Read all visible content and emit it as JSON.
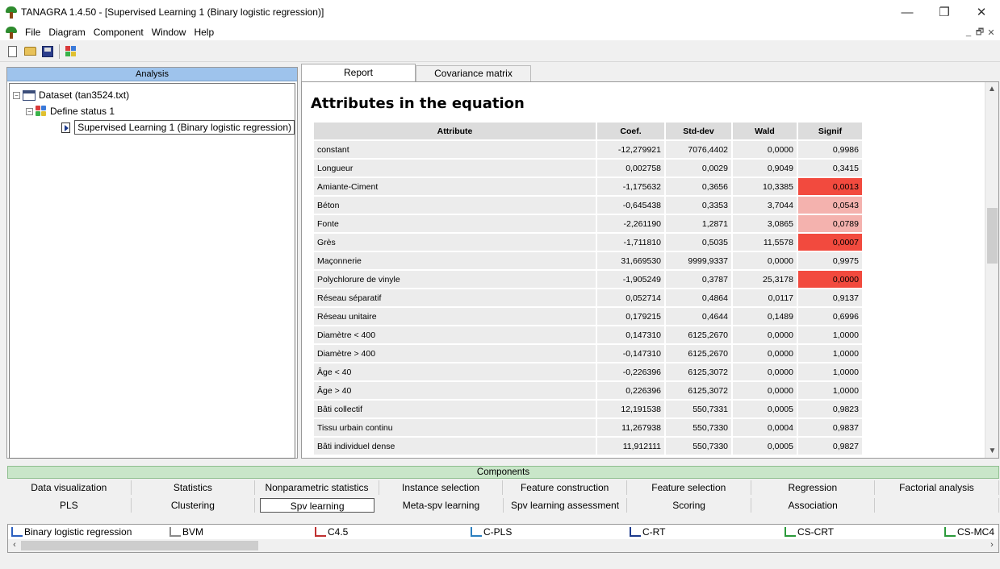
{
  "window": {
    "title": "TANAGRA 1.4.50 - [Supervised Learning 1 (Binary logistic regression)]",
    "minimize": "—",
    "maximize": "❐",
    "close": "✕"
  },
  "menu": {
    "items": [
      "File",
      "Diagram",
      "Component",
      "Window",
      "Help"
    ],
    "mdi": [
      "_",
      "🗗",
      "✕"
    ]
  },
  "toolbar": {
    "icons": [
      "new-file-icon",
      "open-folder-icon",
      "save-disk-icon",
      "execute-icon"
    ]
  },
  "analysis": {
    "header": "Analysis",
    "tree": [
      {
        "label": "Dataset (tan3524.txt)",
        "icon": "dataset-grid-icon",
        "expander": "−"
      },
      {
        "label": "Define status 1",
        "icon": "define-status-icon",
        "expander": "−"
      },
      {
        "label": "Supervised Learning 1 (Binary logistic regression)",
        "icon": "learning-arrow-icon"
      }
    ]
  },
  "tabs": [
    {
      "label": "Report",
      "active": true
    },
    {
      "label": "Covariance matrix",
      "active": false
    }
  ],
  "report": {
    "title": "Attributes in the equation",
    "columns": [
      "Attribute",
      "Coef.",
      "Std-dev",
      "Wald",
      "Signif"
    ],
    "rows": [
      {
        "attr": "constant",
        "coef": "-12,279921",
        "std": "7076,4402",
        "wald": "0,0000",
        "signif": "0,9986",
        "level": "none"
      },
      {
        "attr": "Longueur",
        "coef": "0,002758",
        "std": "0,0029",
        "wald": "0,9049",
        "signif": "0,3415",
        "level": "none"
      },
      {
        "attr": "Amiante-Ciment",
        "coef": "-1,175632",
        "std": "0,3656",
        "wald": "10,3385",
        "signif": "0,0013",
        "level": "strong"
      },
      {
        "attr": "Béton",
        "coef": "-0,645438",
        "std": "0,3353",
        "wald": "3,7044",
        "signif": "0,0543",
        "level": "weak"
      },
      {
        "attr": "Fonte",
        "coef": "-2,261190",
        "std": "1,2871",
        "wald": "3,0865",
        "signif": "0,0789",
        "level": "weak"
      },
      {
        "attr": "Grès",
        "coef": "-1,711810",
        "std": "0,5035",
        "wald": "11,5578",
        "signif": "0,0007",
        "level": "strong"
      },
      {
        "attr": "Maçonnerie",
        "coef": "31,669530",
        "std": "9999,9337",
        "wald": "0,0000",
        "signif": "0,9975",
        "level": "none"
      },
      {
        "attr": "Polychlorure de vinyle",
        "coef": "-1,905249",
        "std": "0,3787",
        "wald": "25,3178",
        "signif": "0,0000",
        "level": "strong"
      },
      {
        "attr": "Réseau séparatif",
        "coef": "0,052714",
        "std": "0,4864",
        "wald": "0,0117",
        "signif": "0,9137",
        "level": "none"
      },
      {
        "attr": "Réseau unitaire",
        "coef": "0,179215",
        "std": "0,4644",
        "wald": "0,1489",
        "signif": "0,6996",
        "level": "none"
      },
      {
        "attr": "Diamètre < 400",
        "coef": "0,147310",
        "std": "6125,2670",
        "wald": "0,0000",
        "signif": "1,0000",
        "level": "none"
      },
      {
        "attr": "Diamètre > 400",
        "coef": "-0,147310",
        "std": "6125,2670",
        "wald": "0,0000",
        "signif": "1,0000",
        "level": "none"
      },
      {
        "attr": "Âge < 40",
        "coef": "-0,226396",
        "std": "6125,3072",
        "wald": "0,0000",
        "signif": "1,0000",
        "level": "none"
      },
      {
        "attr": "Âge > 40",
        "coef": "0,226396",
        "std": "6125,3072",
        "wald": "0,0000",
        "signif": "1,0000",
        "level": "none"
      },
      {
        "attr": "Bâti collectif",
        "coef": "12,191538",
        "std": "550,7331",
        "wald": "0,0005",
        "signif": "0,9823",
        "level": "none"
      },
      {
        "attr": "Tissu urbain continu",
        "coef": "11,267938",
        "std": "550,7330",
        "wald": "0,0004",
        "signif": "0,9837",
        "level": "none"
      },
      {
        "attr": "Bâti individuel dense",
        "coef": "11,912111",
        "std": "550,7330",
        "wald": "0,0005",
        "signif": "0,9827",
        "level": "none"
      }
    ],
    "colors": {
      "strong": "#f24a3e",
      "weak": "#f4b2ae"
    }
  },
  "components": {
    "header": "Components",
    "row1": [
      "Data visualization",
      "Statistics",
      "Nonparametric statistics",
      "Instance selection",
      "Feature construction",
      "Feature selection",
      "Regression",
      "Factorial analysis"
    ],
    "row2": [
      "PLS",
      "Clustering",
      "Spv learning",
      "Meta-spv learning",
      "Spv learning assessment",
      "Scoring",
      "Association",
      ""
    ],
    "active": "Spv learning",
    "algorithms": [
      "Binary logistic regression",
      "BVM",
      "C4.5",
      "C-PLS",
      "C-RT",
      "CS-CRT",
      "CS-MC4"
    ]
  }
}
